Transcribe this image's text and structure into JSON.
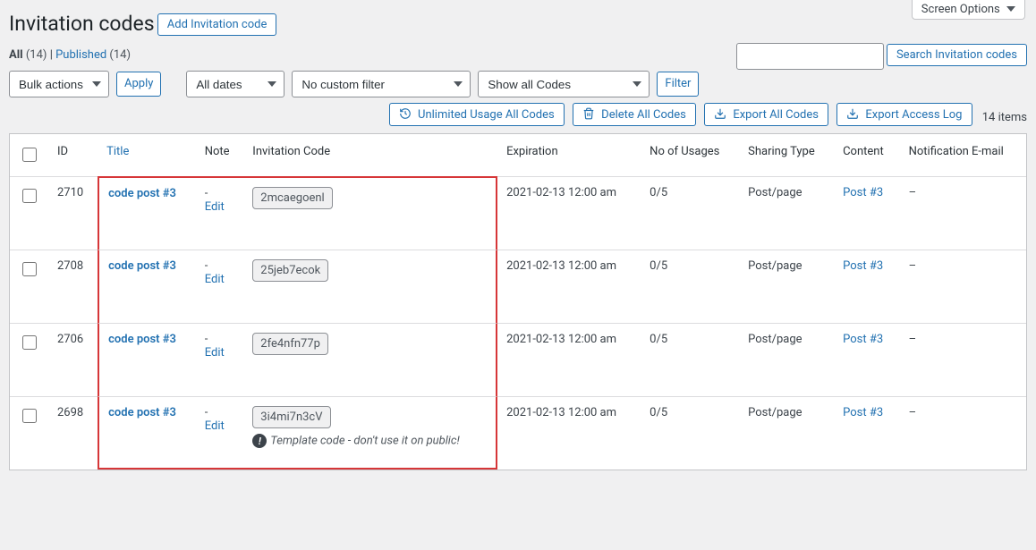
{
  "screen_options": "Screen Options",
  "page_title": "Invitation codes",
  "add_button": "Add Invitation code",
  "views": {
    "all_label": "All",
    "all_count": "(14)",
    "published_label": "Published",
    "published_count": "(14)"
  },
  "search": {
    "button": "Search Invitation codes",
    "value": ""
  },
  "filters": {
    "bulk": "Bulk actions",
    "apply": "Apply",
    "dates": "All dates",
    "custom": "No custom filter",
    "show": "Show all Codes",
    "filter_btn": "Filter"
  },
  "action_buttons": {
    "unlimited": "Unlimited Usage All Codes",
    "delete": "Delete All Codes",
    "export_codes": "Export All Codes",
    "export_log": "Export Access Log"
  },
  "items_label": "14 items",
  "columns": {
    "id": "ID",
    "title": "Title",
    "note": "Note",
    "code": "Invitation Code",
    "expiration": "Expiration",
    "usages": "No of Usages",
    "sharing": "Sharing Type",
    "content": "Content",
    "email": "Notification E-mail"
  },
  "rows": [
    {
      "id": "2710",
      "title": "code post #3",
      "note": "-",
      "edit": "Edit",
      "code": "2mcaegoenl",
      "expiration": "2021-02-13 12:00 am",
      "usages": "0/5",
      "sharing": "Post/page",
      "content": "Post #3",
      "email": "–",
      "template_note": ""
    },
    {
      "id": "2708",
      "title": "code post #3",
      "note": "-",
      "edit": "Edit",
      "code": "25jeb7ecok",
      "expiration": "2021-02-13 12:00 am",
      "usages": "0/5",
      "sharing": "Post/page",
      "content": "Post #3",
      "email": "–",
      "template_note": ""
    },
    {
      "id": "2706",
      "title": "code post #3",
      "note": "-",
      "edit": "Edit",
      "code": "2fe4nfn77p",
      "expiration": "2021-02-13 12:00 am",
      "usages": "0/5",
      "sharing": "Post/page",
      "content": "Post #3",
      "email": "–",
      "template_note": ""
    },
    {
      "id": "2698",
      "title": "code post #3",
      "note": "-",
      "edit": "Edit",
      "code": "3i4mi7n3cV",
      "expiration": "2021-02-13 12:00 am",
      "usages": "0/5",
      "sharing": "Post/page",
      "content": "Post #3",
      "email": "–",
      "template_note": "Template code - don't use it on public!"
    }
  ]
}
